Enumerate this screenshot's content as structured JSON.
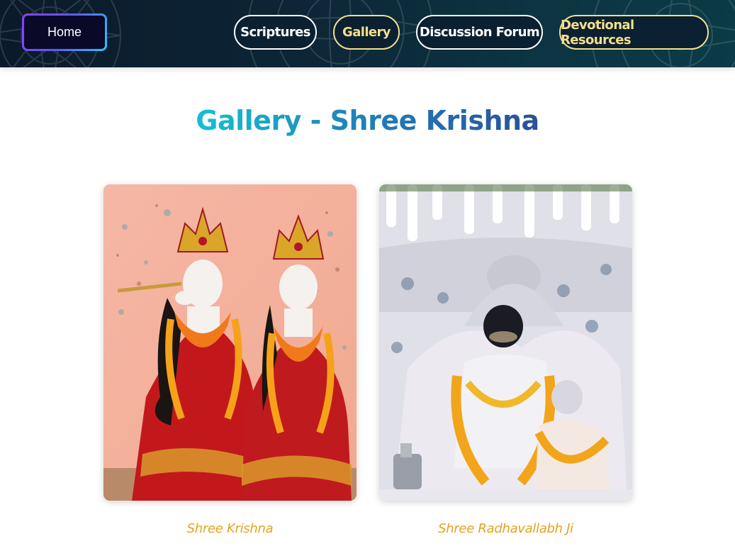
{
  "nav": {
    "home_label": "Home",
    "items": [
      {
        "label": "Scriptures"
      },
      {
        "label": "Gallery"
      },
      {
        "label": "Discussion Forum"
      },
      {
        "label": "Devotional Resources"
      }
    ]
  },
  "title": "Gallery - Shree Krishna",
  "gallery": [
    {
      "caption": "Shree Krishna"
    },
    {
      "caption": "Shree Radhavallabh Ji"
    }
  ],
  "colors": {
    "header_bg": "#0c2a3a",
    "title_gradient_start": "#16c0d2",
    "title_gradient_end": "#2b4f9d",
    "caption": "#e6a21f",
    "nav_gold": "#f3df8b"
  }
}
